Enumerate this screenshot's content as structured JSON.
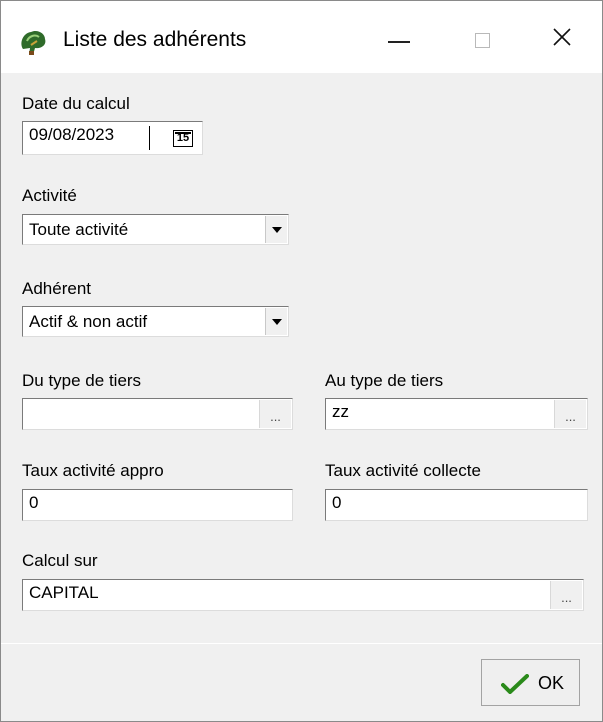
{
  "window": {
    "title": "Liste des adhérents"
  },
  "form": {
    "date_label": "Date du calcul",
    "date_value": "09/08/2023",
    "calendar_day": "15",
    "activity_label": "Activité",
    "activity_value": "Toute activité",
    "member_label": "Adhérent",
    "member_value": "Actif & non actif",
    "from_type_label": "Du type de tiers",
    "from_type_value": "",
    "to_type_label": "Au type de tiers",
    "to_type_value": "zz",
    "rate_supply_label": "Taux activité appro",
    "rate_supply_value": "0",
    "rate_collect_label": "Taux activité collecte",
    "rate_collect_value": "0",
    "calc_on_label": "Calcul sur",
    "calc_on_value": "CAPITAL",
    "ellipsis": "..."
  },
  "buttons": {
    "ok_label": "OK"
  },
  "icons": {
    "app": "app-tree-icon",
    "minimize": "minimize-icon",
    "maximize": "maximize-icon",
    "close": "close-icon",
    "calendar": "calendar-icon",
    "dropdown": "chevron-down-icon",
    "ok": "checkmark-icon"
  },
  "colors": {
    "checkmark": "#2a8a1a",
    "window_bg": "#f0f0f0"
  }
}
